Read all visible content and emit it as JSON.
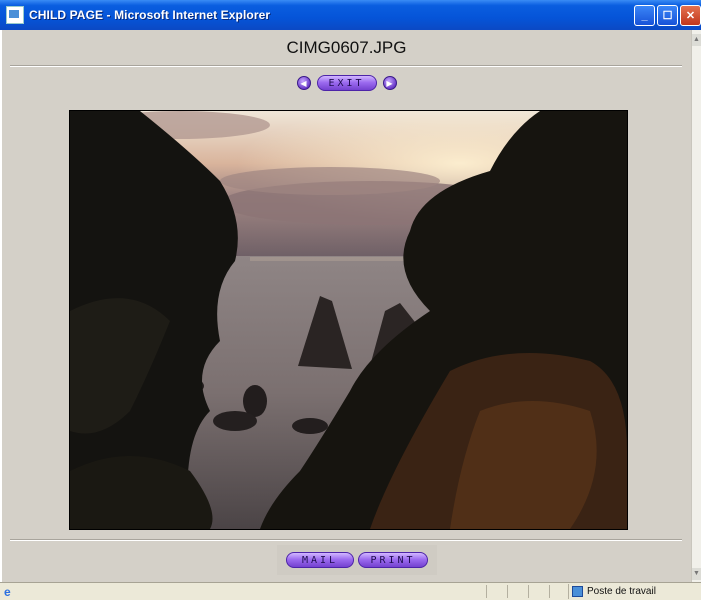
{
  "window": {
    "title": "CHILD PAGE - Microsoft Internet Explorer",
    "buttons": [
      "minimize",
      "maximize",
      "close"
    ]
  },
  "page": {
    "title": "CIMG0607.JPG",
    "nav": {
      "prev_icon": "triangle-left",
      "exit_label": "EXIT",
      "next_icon": "triangle-right"
    },
    "photo": {
      "subject": "sunset seascape with rocks framed by trees"
    },
    "actions": {
      "mail_label": "MAIL",
      "print_label": "PRINT"
    }
  },
  "statusbar": {
    "zone": "Poste de travail"
  },
  "colors": {
    "accent": "#8a55e6",
    "titlebar": "#0554d8",
    "panel": "#d4d0c8"
  }
}
